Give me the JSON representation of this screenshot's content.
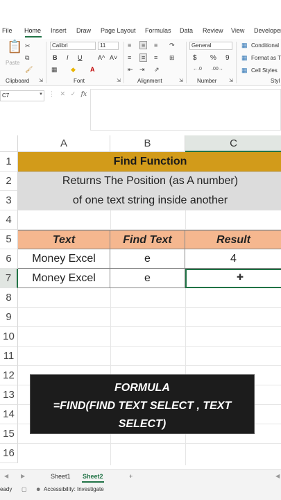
{
  "ribbon": {
    "tabs": [
      "File",
      "Home",
      "Insert",
      "Draw",
      "Page Layout",
      "Formulas",
      "Data",
      "Review",
      "View",
      "Developer"
    ],
    "active_tab": "Home",
    "clipboard": {
      "paste_label": "Paste",
      "group_label": "Clipboard"
    },
    "font": {
      "font_name": "Calibri",
      "font_size": "11",
      "bold": "B",
      "italic": "I",
      "underline": "U",
      "grow": "A^",
      "shrink": "A˅",
      "group_label": "Font"
    },
    "alignment": {
      "group_label": "Alignment"
    },
    "number": {
      "format": "General",
      "currency": "$",
      "percent": "%",
      "comma": "9",
      "group_label": "Number"
    },
    "styles": {
      "conditional": "Conditional",
      "format_as": "Format as T",
      "cell_styles": "Cell Styles",
      "group_label": "Styl"
    }
  },
  "formula_bar": {
    "name_box": "C7",
    "fx": "fx"
  },
  "columns": [
    "A",
    "B",
    "C"
  ],
  "rows": [
    "1",
    "2",
    "3",
    "4",
    "5",
    "6",
    "7",
    "8",
    "9",
    "10",
    "11",
    "12",
    "13",
    "14",
    "15",
    "16"
  ],
  "sheet": {
    "title": "Find Function",
    "subtitle_line1": "Returns The Position (as A number)",
    "subtitle_line2": "of one text string inside another",
    "headers": [
      "Text",
      "Find Text",
      "Result"
    ],
    "rows": [
      [
        "Money Excel",
        "e",
        "4"
      ],
      [
        "Money Excel",
        "e",
        ""
      ]
    ]
  },
  "overlay": {
    "line1": "FORMULA",
    "line2": "=FIND(FIND TEXT SELECT , TEXT SELECT)"
  },
  "sheet_tabs": [
    "Sheet1",
    "Sheet2"
  ],
  "active_sheet": "Sheet2",
  "add_sheet": "+",
  "status": {
    "ready": "eady",
    "accessibility": "Accessibility: Investigate"
  },
  "colors": {
    "accent": "#217346",
    "title_bg": "#d29b1a",
    "header_bg": "#f5b78f",
    "subtitle_bg": "#dcdcdc"
  }
}
